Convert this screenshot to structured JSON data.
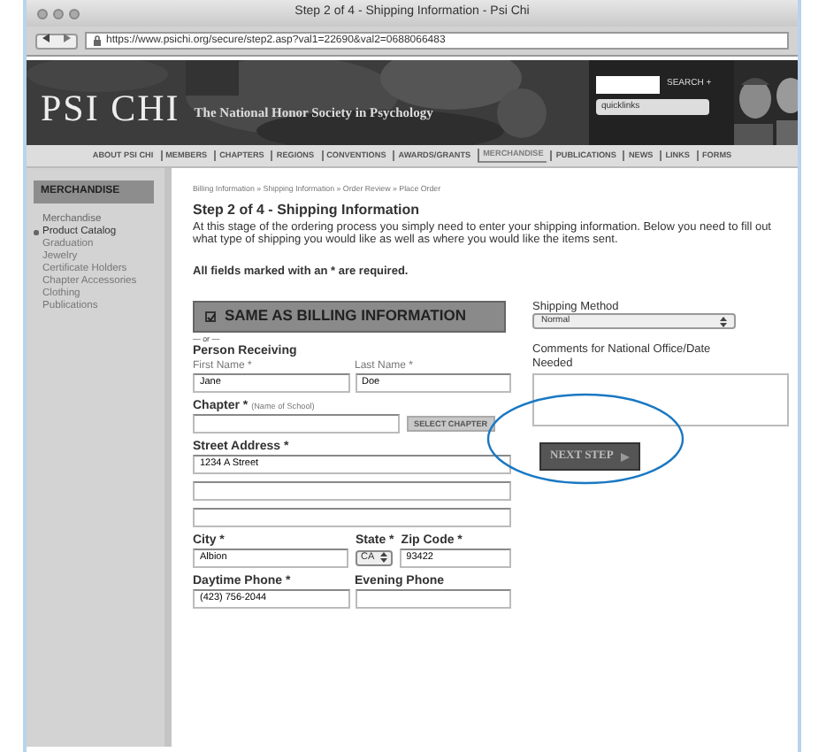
{
  "window": {
    "title": "Step 2 of 4 - Shipping Information - Psi Chi"
  },
  "address_bar": {
    "url": "https://www.psichi.org/secure/step2.asp?val1=22690&val2=0688066483"
  },
  "header": {
    "logo": "PSI CHI",
    "tagline": "The National Honor Society in Psychology",
    "search_button": "SEARCH +",
    "quicklinks": "quicklinks"
  },
  "nav": [
    {
      "label": "ABOUT PSI CHI",
      "selected": false
    },
    {
      "label": "MEMBERS",
      "selected": false
    },
    {
      "label": "CHAPTERS",
      "selected": false
    },
    {
      "label": "REGIONS",
      "selected": false
    },
    {
      "label": "CONVENTIONS",
      "selected": false
    },
    {
      "label": "AWARDS/GRANTS",
      "selected": false
    },
    {
      "label": "MERCHANDISE",
      "selected": true
    },
    {
      "label": "PUBLICATIONS",
      "selected": false
    },
    {
      "label": "NEWS",
      "selected": false
    },
    {
      "label": "LINKS",
      "selected": false
    },
    {
      "label": "FORMS",
      "selected": false
    }
  ],
  "sidebar": {
    "title": "MERCHANDISE",
    "items": [
      {
        "label": "Merchandise",
        "selected": false
      },
      {
        "label": "Product Catalog",
        "selected": true,
        "children": [
          {
            "label": "Graduation"
          },
          {
            "label": "Jewelry"
          },
          {
            "label": "Certificate Holders"
          },
          {
            "label": "Chapter Accessories"
          },
          {
            "label": "Clothing"
          },
          {
            "label": "Publications"
          }
        ]
      }
    ]
  },
  "breadcrumb": "Billing Information » Shipping Information » Order Review » Place Order",
  "heading": "Step 2 of 4 - Shipping Information",
  "intro": "At this stage of the ordering process you simply need to enter your shipping information. Below you need to fill out what type of shipping you would like as well as where you would like the items sent.",
  "required_note": "All fields marked with an * are required.",
  "same_as_billing": {
    "label": "SAME AS BILLING INFORMATION",
    "checked": true
  },
  "or_text": "— or —",
  "person_receiving": "Person Receiving",
  "fields": {
    "first_name": {
      "label": "First Name *",
      "value": "Jane"
    },
    "last_name": {
      "label": "Last Name *",
      "value": "Doe"
    },
    "chapter": {
      "label": "Chapter *",
      "hint": "(Name of School)",
      "button": "SELECT CHAPTER"
    },
    "street": {
      "label": "Street Address *",
      "lines": [
        {
          "kind": "filled",
          "value": "1234 A Street"
        },
        {
          "kind": "blank"
        },
        {
          "kind": "blank"
        }
      ]
    },
    "city": {
      "label": "City *",
      "value": "Albion"
    },
    "state": {
      "label": "State *",
      "value": "CA"
    },
    "zip": {
      "label": "Zip Code *",
      "value": "93422"
    },
    "day_phone": {
      "label": "Daytime Phone *",
      "value": "(423) 756-2044"
    },
    "evening_phone": {
      "label": "Evening Phone"
    }
  },
  "shipping_method": {
    "label": "Shipping Method",
    "value": "Normal"
  },
  "comments": {
    "label": "Comments for National Office/Date Needed"
  },
  "next_step": {
    "label": "NEXT STEP",
    "circled": true
  }
}
